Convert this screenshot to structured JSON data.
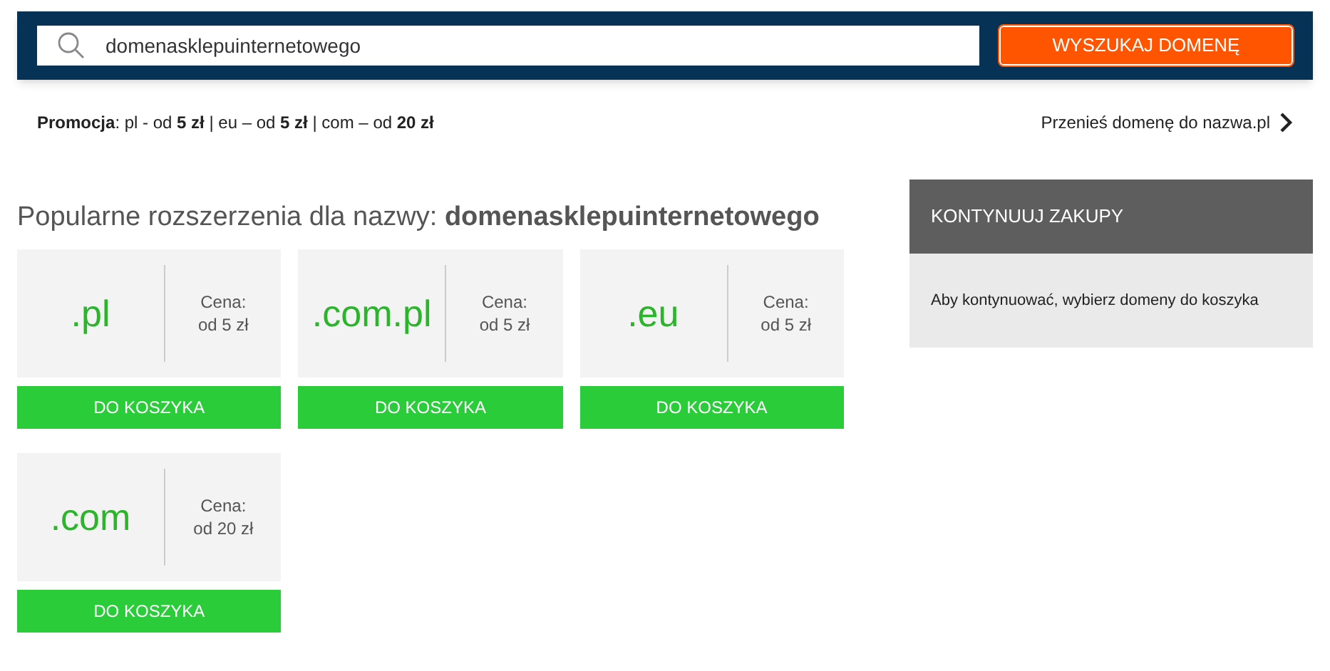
{
  "search": {
    "value": "domenasklepuinternetowego",
    "button": "WYSZUKAJ DOMENĘ"
  },
  "promo": "**Promocja**: pl - od **5 zł** | eu – od **5 zł** | com – od **20 zł**",
  "transfer_link": "Przenieś domenę do nazwa.pl",
  "heading": "Popularne rozszerzenia dla nazwy: **domenasklepuinternetowego**",
  "domains": [
    {
      "extension": ".pl",
      "price_label": "Cena:",
      "price": "od 5 zł",
      "button": "DO KOSZYKA"
    },
    {
      "extension": ".com.pl",
      "price_label": "Cena:",
      "price": "od 5 zł",
      "button": "DO KOSZYKA"
    },
    {
      "extension": ".eu",
      "price_label": "Cena:",
      "price": "od 5 zł",
      "button": "DO KOSZYKA"
    },
    {
      "extension": ".com",
      "price_label": "Cena:",
      "price": "od 20 zł",
      "button": "DO KOSZYKA"
    }
  ],
  "cart": {
    "title": "KONTYNUUJ ZAKUPY",
    "message": "Aby kontynuować, wybierz domeny do koszyka"
  }
}
